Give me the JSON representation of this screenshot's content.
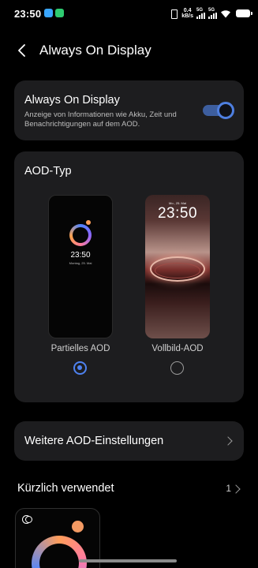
{
  "status_bar": {
    "time": "23:50",
    "net_speed_value": "0.4",
    "net_speed_unit": "kB/s",
    "sim1_label": "5G",
    "sim2_label": "5G"
  },
  "header": {
    "title": "Always On Display"
  },
  "aod_toggle": {
    "title": "Always On Display",
    "description": "Anzeige von Informationen wie Akku, Zeit und Benachrichtigungen auf dem AOD.",
    "enabled": true
  },
  "aod_type": {
    "title": "AOD-Typ",
    "options": [
      {
        "label": "Partielles AOD",
        "selected": true,
        "preview_time": "23:50",
        "preview_date": "Montag, 25. Mai"
      },
      {
        "label": "Vollbild-AOD",
        "selected": false,
        "preview_time": "23:50",
        "preview_date": "Mo., 25. Mai"
      }
    ]
  },
  "more_settings": {
    "label": "Weitere AOD-Einstellungen"
  },
  "recent": {
    "title": "Kürzlich verwendet",
    "count": "1"
  },
  "colors": {
    "accent": "#4e82f0",
    "card_bg": "#1d1d1f",
    "background": "#000000"
  }
}
